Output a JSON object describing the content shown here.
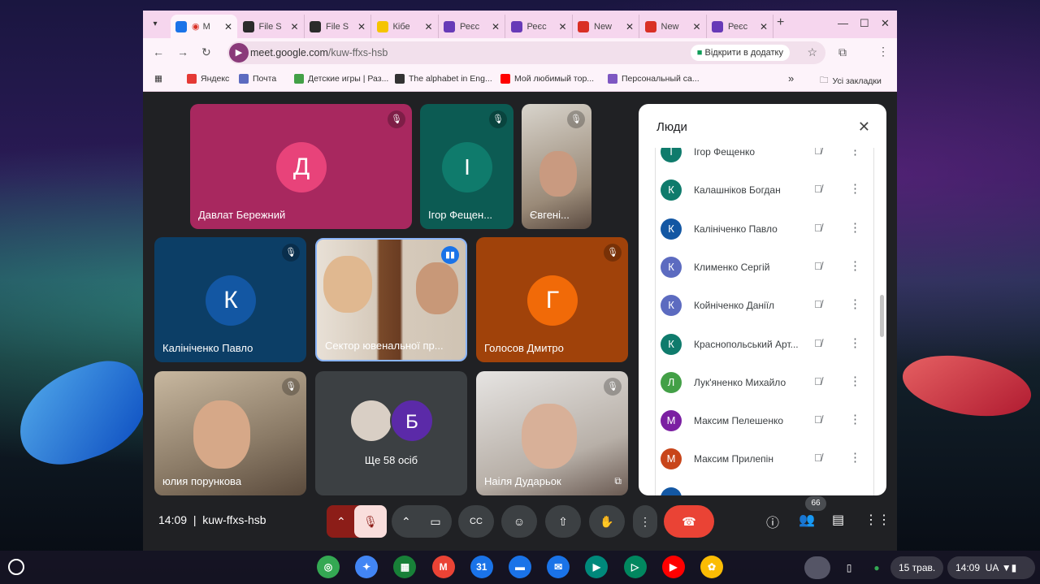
{
  "browser": {
    "tabs": [
      {
        "label": "M",
        "icon": "meet-icon",
        "color": "#1a73e8",
        "active": true,
        "recording": true
      },
      {
        "label": "File S",
        "icon": "file-icon",
        "color": "#2b2b2b"
      },
      {
        "label": "File S",
        "icon": "file-icon",
        "color": "#2b2b2b"
      },
      {
        "label": "Кібе",
        "icon": "b-icon",
        "color": "#f5c400"
      },
      {
        "label": "Реєс",
        "icon": "forms-icon",
        "color": "#673ab7"
      },
      {
        "label": "Реєс",
        "icon": "forms-icon",
        "color": "#673ab7"
      },
      {
        "label": "New",
        "icon": "gmail-icon",
        "color": "#d93025"
      },
      {
        "label": "New",
        "icon": "gmail-icon",
        "color": "#d93025"
      },
      {
        "label": "Реєс",
        "icon": "forms-icon",
        "color": "#673ab7"
      }
    ],
    "url_host": "meet.google.com",
    "url_path": "/kuw-ffxs-hsb",
    "open_in_app": "Відкрити в додатку",
    "bookmarks": [
      {
        "label": "Яндекс",
        "color": "#e53935"
      },
      {
        "label": "Почта",
        "color": "#5c6bc0"
      },
      {
        "label": "Детские игры | Раз...",
        "color": "#43a047"
      },
      {
        "label": "The alphabet in Eng...",
        "color": "#333333"
      },
      {
        "label": "Мой любимый тор...",
        "color": "#ff0000"
      },
      {
        "label": "Персональный са...",
        "color": "#7e57c2"
      }
    ],
    "all_bookmarks": "Усі закладки"
  },
  "tiles": {
    "davlat": {
      "name": "Давлат Бережний",
      "initial": "Д",
      "bg": "#a8285f",
      "avatar": "#e8437a"
    },
    "igor": {
      "name": "Ігор Фещен...",
      "initial": "І",
      "bg": "#0c5b53",
      "avatar": "#0f7b6c"
    },
    "evgen": {
      "name": "Євгені..."
    },
    "kalinichenko": {
      "name": "Калініченко Павло",
      "initial": "К",
      "bg": "#0c3e66",
      "avatar": "#1357a3"
    },
    "sector": {
      "name": "Сектор ювенальної пр..."
    },
    "golosov": {
      "name": "Голосов Дмитро",
      "initial": "Г",
      "bg": "#a0420a",
      "avatar": "#f16a08"
    },
    "yulia": {
      "name": "юлия порункова"
    },
    "more": {
      "label": "Ще 58 осіб",
      "initial": "Б",
      "avatar": "#5b2aa8"
    },
    "nailya": {
      "name": "Наіля Дударьок"
    }
  },
  "people_panel": {
    "title": "Люди",
    "items": [
      {
        "name": "Ігор Фещенко",
        "initial": "І",
        "color": "#0f7b6c"
      },
      {
        "name": "Калашніков Богдан",
        "initial": "К",
        "color": "#0f7b6c"
      },
      {
        "name": "Калініченко Павло",
        "initial": "К",
        "color": "#1357a3"
      },
      {
        "name": "Клименко Сергій",
        "initial": "К",
        "color": "#5c6bc0"
      },
      {
        "name": "Койніченко Даніїл",
        "initial": "К",
        "color": "#5c6bc0"
      },
      {
        "name": "Краснопольський Арт...",
        "initial": "К",
        "color": "#0f7b6c"
      },
      {
        "name": "Лук'яненко Михайло",
        "initial": "Л",
        "color": "#43a047"
      },
      {
        "name": "Максим Пелешенко",
        "initial": "М",
        "color": "#7b1fa2"
      },
      {
        "name": "Максим Прилепін",
        "initial": "М",
        "color": "#c8451a"
      }
    ]
  },
  "meeting": {
    "time": "14:09",
    "code": "kuw-ffxs-hsb",
    "separator": "|",
    "participants_count": "66",
    "end_color": "#ea4335"
  },
  "shelf": {
    "apps": [
      {
        "name": "chrome",
        "color": "#34a853",
        "glyph": "◎"
      },
      {
        "name": "gemini",
        "color": "#4285f4",
        "glyph": "✦"
      },
      {
        "name": "apps",
        "color": "#188038",
        "glyph": "▦"
      },
      {
        "name": "gmail",
        "color": "#ea4335",
        "glyph": "M"
      },
      {
        "name": "calendar",
        "color": "#1a73e8",
        "glyph": "31"
      },
      {
        "name": "files",
        "color": "#1a73e8",
        "glyph": "▬"
      },
      {
        "name": "chat",
        "color": "#1a73e8",
        "glyph": "✉"
      },
      {
        "name": "meet",
        "color": "#00897b",
        "glyph": "▶"
      },
      {
        "name": "play",
        "color": "#01875f",
        "glyph": "▷"
      },
      {
        "name": "youtube",
        "color": "#ff0000",
        "glyph": "▶"
      },
      {
        "name": "photos",
        "color": "#fbbc04",
        "glyph": "✿"
      }
    ],
    "date": "15 трав.",
    "time": "14:09",
    "lang": "UA"
  }
}
